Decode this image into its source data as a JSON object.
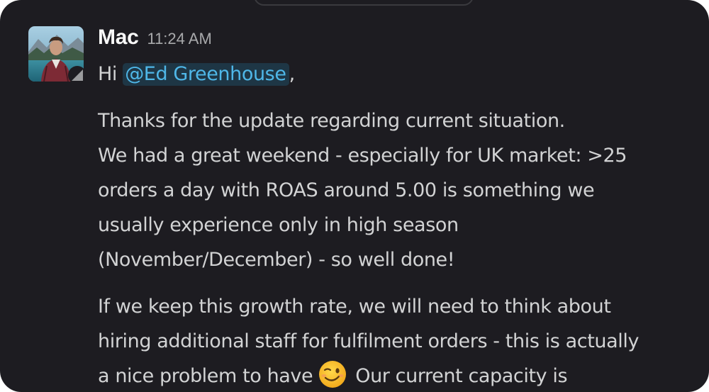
{
  "message": {
    "sender_name": "Mac",
    "timestamp": "11:24 AM",
    "greeting_prefix": "Hi ",
    "mention": "@Ed Greenhouse",
    "greeting_suffix": ",",
    "paragraph1": [
      "Thanks for the update regarding current situation.",
      "We had a great weekend - especially for UK market: >25",
      "orders a day with ROAS around 5.00 is something we",
      "usually experience only in high season",
      "(November/December) - so well done!"
    ],
    "paragraph2_lines": [
      "If we keep this growth rate, we will need to think about",
      "hiring additional staff for fulfilment orders - this is actually"
    ],
    "paragraph2_before_emoji": "a nice problem to have",
    "emoji_icon": "winking-face-emoji",
    "paragraph2_after_emoji": "Our current capacity is"
  },
  "colors": {
    "background": "#1d1c21",
    "text": "#d2d3d4",
    "mention_text": "#4fb7e8",
    "mention_bg": "#1e3645"
  }
}
